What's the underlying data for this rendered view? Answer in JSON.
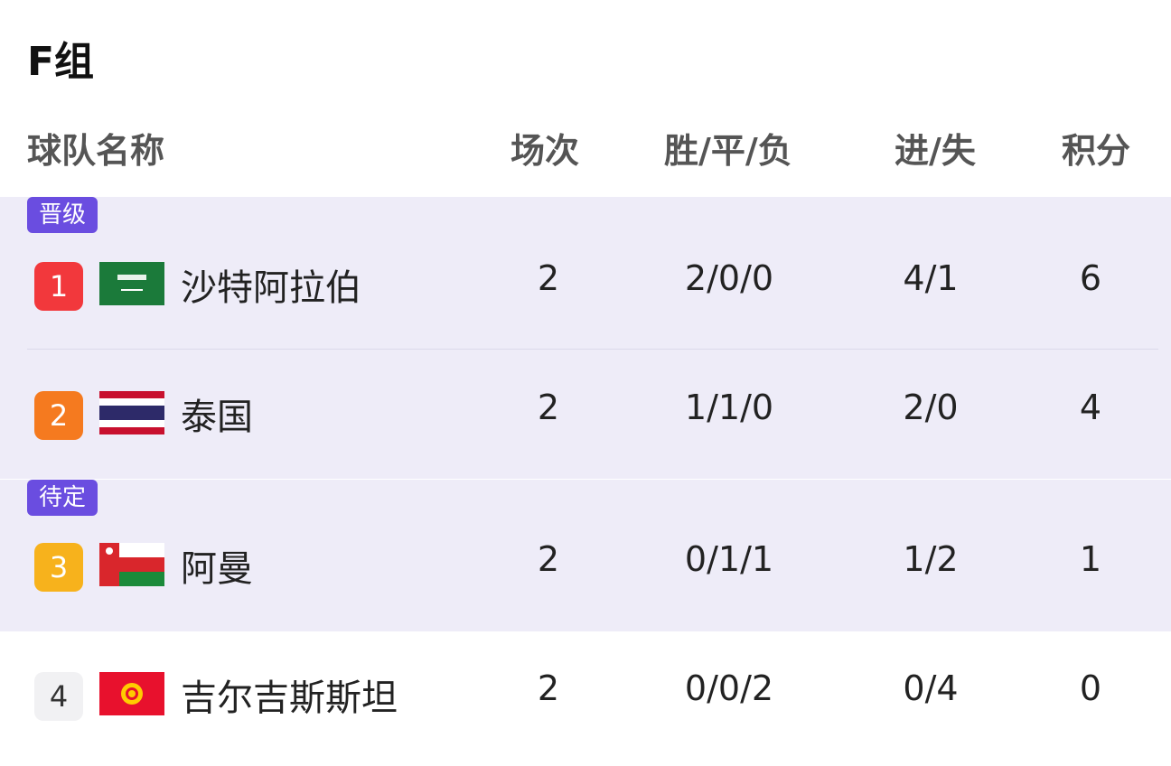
{
  "group_title": "F组",
  "columns": {
    "team": "球队名称",
    "played": "场次",
    "wdl": "胜/平/负",
    "goals": "进/失",
    "points": "积分"
  },
  "sections": {
    "qualified": "晋级",
    "pending": "待定"
  },
  "rows": [
    {
      "rank": "1",
      "team": "沙特阿拉伯",
      "played": "2",
      "wdl": "2/0/0",
      "goals": "4/1",
      "points": "6",
      "rank_color": "#f2383c",
      "flag": "saudi-arabia"
    },
    {
      "rank": "2",
      "team": "泰国",
      "played": "2",
      "wdl": "1/1/0",
      "goals": "2/0",
      "points": "4",
      "rank_color": "#f57a1f",
      "flag": "thailand"
    },
    {
      "rank": "3",
      "team": "阿曼",
      "played": "2",
      "wdl": "0/1/1",
      "goals": "1/2",
      "points": "1",
      "rank_color": "#f7b21c",
      "flag": "oman"
    },
    {
      "rank": "4",
      "team": "吉尔吉斯斯坦",
      "played": "2",
      "wdl": "0/0/2",
      "goals": "0/4",
      "points": "0",
      "rank_color": "#f1f1f3",
      "flag": "kyrgyzstan"
    }
  ],
  "colors": {
    "accent_tag": "#6a4de0",
    "highlight_band": "#eeecf8"
  }
}
